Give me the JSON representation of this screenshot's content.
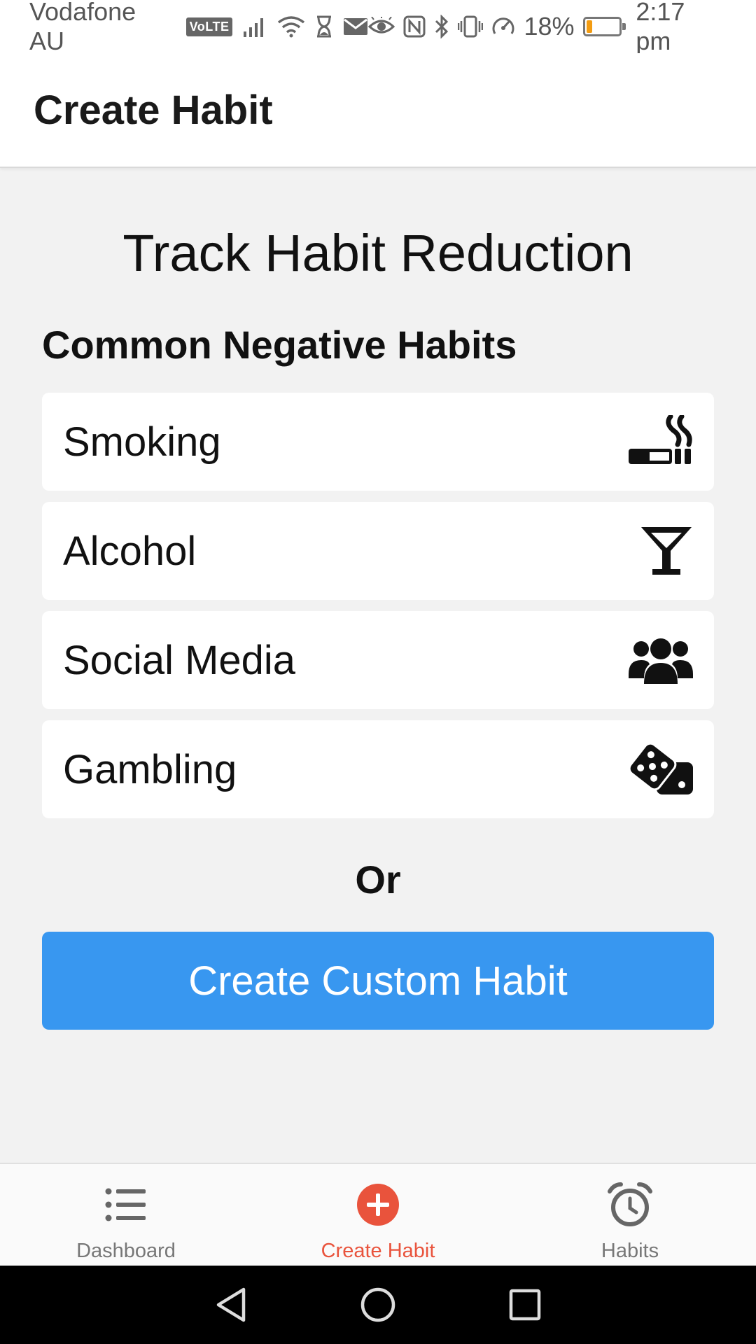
{
  "status_bar": {
    "carrier": "Vodafone AU",
    "volte": "VoLTE",
    "battery_percent": "18%",
    "battery_level": 0.18,
    "time": "2:17 pm"
  },
  "app_bar": {
    "title": "Create Habit"
  },
  "main": {
    "heading": "Track Habit Reduction",
    "section_label": "Common Negative Habits",
    "habits": [
      {
        "label": "Smoking",
        "icon": "smoking-icon"
      },
      {
        "label": "Alcohol",
        "icon": "cocktail-icon"
      },
      {
        "label": "Social Media",
        "icon": "users-icon"
      },
      {
        "label": "Gambling",
        "icon": "dice-icon"
      }
    ],
    "or_text": "Or",
    "custom_button_label": "Create Custom Habit"
  },
  "bottom_nav": {
    "items": [
      {
        "label": "Dashboard",
        "icon": "list-icon",
        "active": false
      },
      {
        "label": "Create Habit",
        "icon": "plus-circle-icon",
        "active": true
      },
      {
        "label": "Habits",
        "icon": "alarm-clock-icon",
        "active": false
      }
    ]
  },
  "colors": {
    "accent_blue": "#3897f0",
    "active_tab": "#e9533c",
    "background": "#f2f2f2",
    "battery_low": "#f39c12"
  }
}
